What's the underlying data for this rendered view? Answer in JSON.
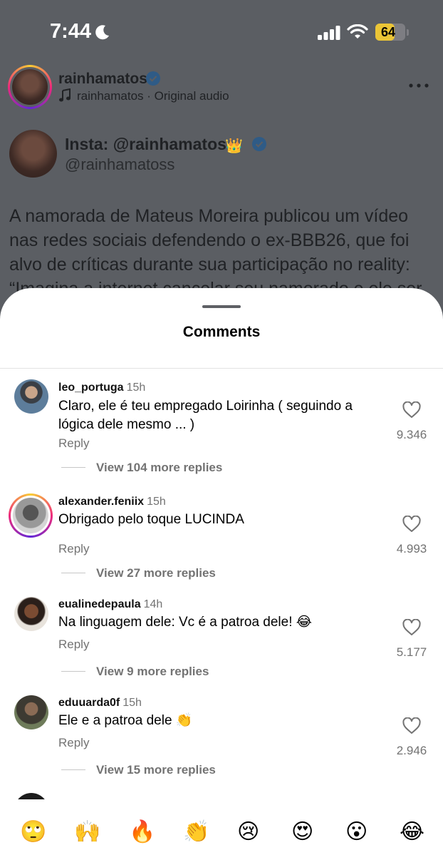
{
  "status": {
    "time": "7:44",
    "battery": "64",
    "battery_level": 0.64
  },
  "post": {
    "username": "rainhamatos",
    "audio": "rainhamatos · Original audio",
    "tweet_name": "Insta: @rainhamatos",
    "tweet_handle": "@rainhamatoss",
    "tweet_text": "A namorada de Mateus Moreira publicou um vídeo nas redes sociais defendendo o ex-BBB26, que foi alvo de críticas durante sua participação no reality: “Imagina a internet cancelar seu namorado e ele ser"
  },
  "sheet": {
    "title": "Comments",
    "comments": [
      {
        "user": "leo_portuga",
        "time": "15h",
        "text": "Claro, ele é teu empregado Loirinha ( seguindo a lógica dele mesmo ... )",
        "reply": "Reply",
        "more": "View 104 more replies",
        "likes": "9.346"
      },
      {
        "user": "alexander.feniix",
        "time": "15h",
        "text": "Obrigado pelo toque LUCINDA",
        "reply": "Reply",
        "more": "View 27 more replies",
        "likes": "4.993"
      },
      {
        "user": "eualinedepaula",
        "time": "14h",
        "text": "Na linguagem dele: Vc é a patroa dele! 😂",
        "reply": "Reply",
        "more": "View 9 more replies",
        "likes": "5.177"
      },
      {
        "user": "eduuarda0f",
        "time": "15h",
        "text": "Ele e a patroa dele 👏",
        "reply": "Reply",
        "more": "View 15 more replies",
        "likes": "2.946"
      }
    ]
  },
  "emojis": [
    "🙄",
    "🙌",
    "🔥",
    "👏",
    "😢",
    "😍",
    "😮",
    "😂"
  ]
}
